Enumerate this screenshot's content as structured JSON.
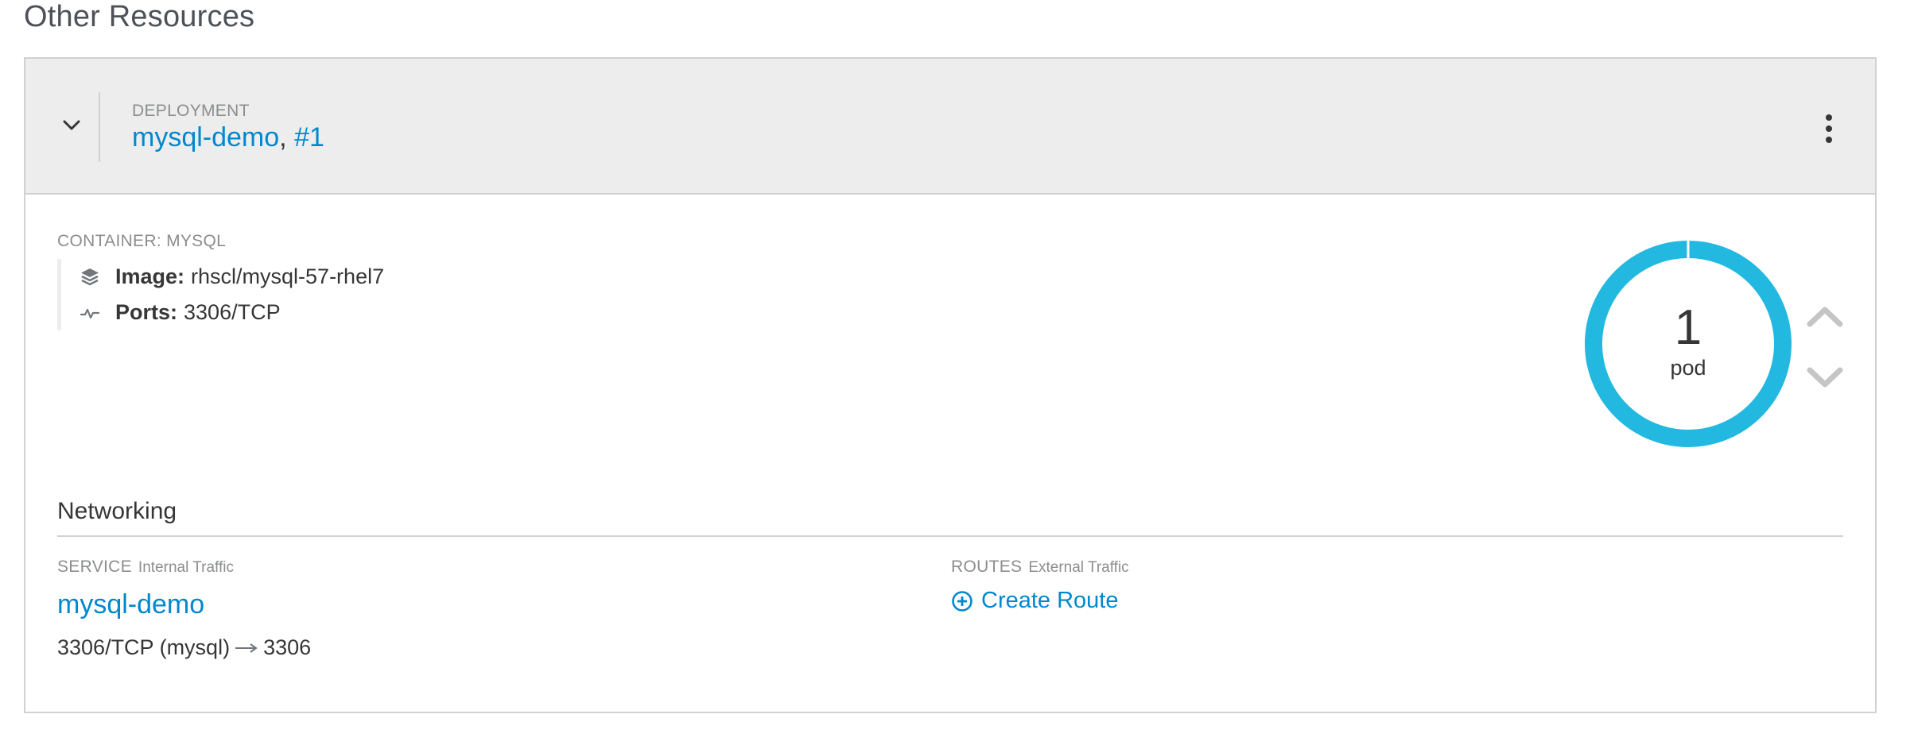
{
  "section": {
    "title": "Other Resources"
  },
  "deployment": {
    "kind_label": "DEPLOYMENT",
    "name": "mysql-demo",
    "separator": ",",
    "revision": "#1"
  },
  "container": {
    "label": "CONTAINER: MYSQL",
    "image_label": "Image:",
    "image_value": "rhscl/mysql-57-rhel7",
    "ports_label": "Ports:",
    "ports_value": "3306/TCP"
  },
  "pods": {
    "count": "1",
    "unit": "pod",
    "ring_color": "#22b8e0"
  },
  "networking": {
    "title": "Networking",
    "service": {
      "label": "SERVICE",
      "sublabel": "Internal Traffic",
      "name": "mysql-demo",
      "port_from": "3306/TCP (mysql)",
      "port_to": "3306"
    },
    "routes": {
      "label": "ROUTES",
      "sublabel": "External Traffic",
      "create_label": "Create Route"
    }
  },
  "icons": {
    "collapse": "chevron-down-icon",
    "menu": "kebab-icon",
    "image": "layers-icon",
    "ports": "pulse-icon",
    "scale_up": "chevron-up-icon",
    "scale_down": "chevron-down-icon",
    "create": "plus-circle-icon",
    "arrow": "arrow-right-icon"
  },
  "colors": {
    "link": "#0088ce",
    "header_bg": "#ededed",
    "muted": "#8b8d8f"
  }
}
